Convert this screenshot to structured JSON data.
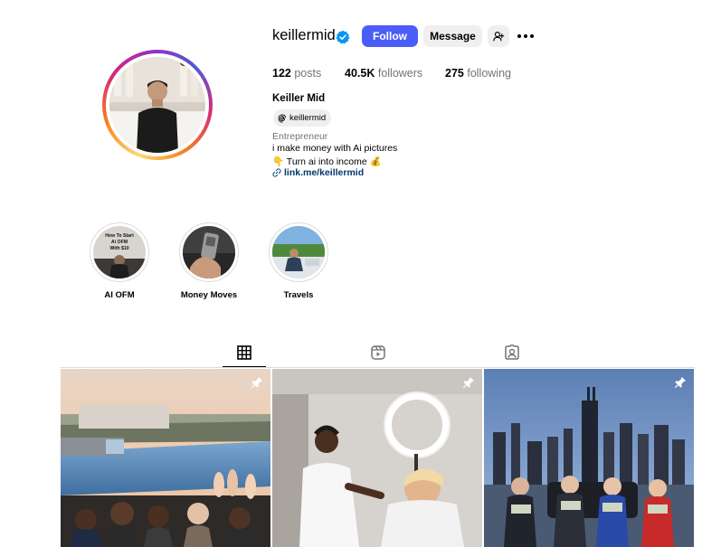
{
  "profile": {
    "username": "keillermid",
    "verified": true,
    "follow_label": "Follow",
    "message_label": "Message",
    "posts_count": "122",
    "posts_label": "posts",
    "followers_count": "40.5K",
    "followers_label": "followers",
    "following_count": "275",
    "following_label": "following",
    "full_name": "Keiller Mid",
    "threads_handle": "keillermid",
    "category": "Entrepreneur",
    "bio_line1": "i make money with Ai pictures",
    "bio_line2": "👇 Turn ai into income 💰",
    "link": "link.me/keillermid"
  },
  "highlights": [
    {
      "label": "AI OFM",
      "cover_text": "How To Start Ai OFM With $10"
    },
    {
      "label": "Money Moves"
    },
    {
      "label": "Travels"
    }
  ],
  "tabs": [
    {
      "name": "posts",
      "icon": "grid-icon",
      "active": true
    },
    {
      "name": "reels",
      "icon": "reels-icon",
      "active": false
    },
    {
      "name": "tagged",
      "icon": "tagged-icon",
      "active": false
    }
  ],
  "posts": [
    {
      "pinned": true
    },
    {
      "pinned": true
    },
    {
      "pinned": true
    }
  ],
  "colors": {
    "follow_button": "#4a5df9",
    "secondary_button": "#efefef",
    "verified": "#0095f6",
    "link": "#00376b"
  }
}
